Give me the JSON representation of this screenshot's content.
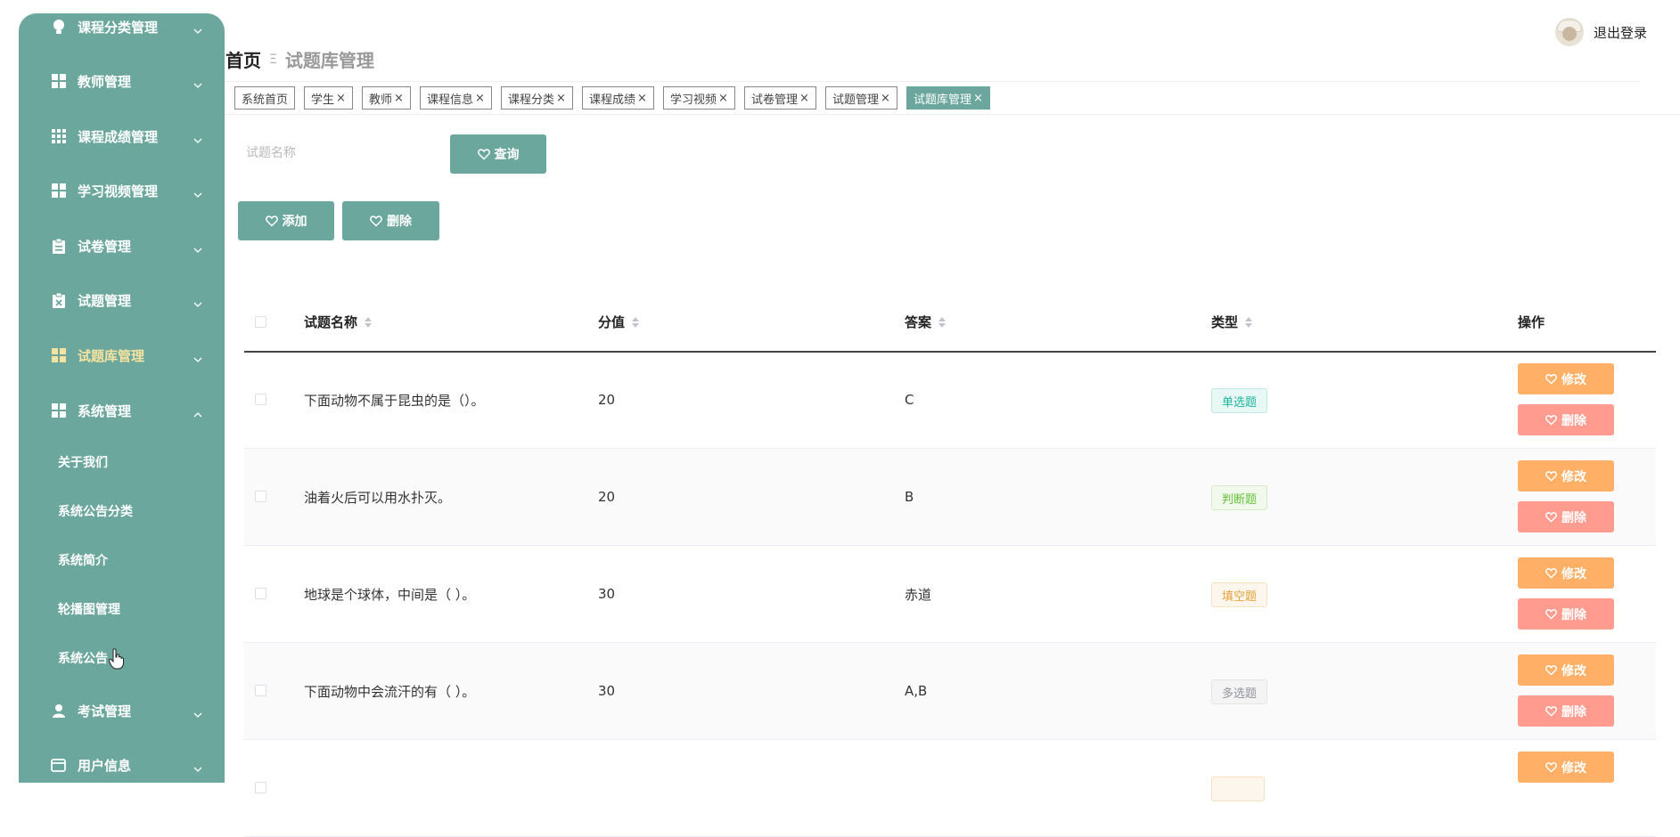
{
  "sidebar": {
    "menu": [
      {
        "label": "课程分类管理",
        "icon": "lightbulb-icon"
      },
      {
        "label": "教师管理",
        "icon": "grid-icon"
      },
      {
        "label": "课程成绩管理",
        "icon": "grid-9-icon"
      },
      {
        "label": "学习视频管理",
        "icon": "grid-icon"
      },
      {
        "label": "试卷管理",
        "icon": "clipboard-icon"
      },
      {
        "label": "试题管理",
        "icon": "clipboard-x-icon"
      },
      {
        "label": "试题库管理",
        "icon": "grid-icon",
        "active": true
      },
      {
        "label": "系统管理",
        "icon": "grid-icon",
        "expanded": true
      }
    ],
    "sub_items": [
      "关于我们",
      "系统公告分类",
      "系统简介",
      "轮播图管理",
      "系统公告"
    ],
    "menu_bottom": [
      {
        "label": "考试管理",
        "icon": "user-icon"
      },
      {
        "label": "用户信息",
        "icon": "card-icon"
      }
    ]
  },
  "header": {
    "home": "首页",
    "separator": "Ξ",
    "current": "试题库管理",
    "logout_label": "退出登录"
  },
  "tags": [
    {
      "label": "系统首页",
      "closable": false
    },
    {
      "label": "学生",
      "closable": true
    },
    {
      "label": "教师",
      "closable": true
    },
    {
      "label": "课程信息",
      "closable": true
    },
    {
      "label": "课程分类",
      "closable": true
    },
    {
      "label": "课程成绩",
      "closable": true
    },
    {
      "label": "学习视频",
      "closable": true
    },
    {
      "label": "试卷管理",
      "closable": true
    },
    {
      "label": "试题管理",
      "closable": true
    },
    {
      "label": "试题库管理",
      "closable": true,
      "active": true
    }
  ],
  "tag_close": "×",
  "search": {
    "placeholder": "试题名称",
    "button_label": "查询"
  },
  "actions": {
    "add_label": "添加",
    "delete_label": "删除"
  },
  "table": {
    "columns": [
      "试题名称",
      "分值",
      "答案",
      "类型",
      "操作"
    ],
    "rows": [
      {
        "name": "下面动物不属于昆虫的是（）。",
        "score": "20",
        "answer": "C",
        "type": "单选题",
        "type_color": "#1fb5a0"
      },
      {
        "name": "油着火后可以用水扑灭。",
        "score": "20",
        "answer": "B",
        "type": "判断题",
        "type_color": "#67c23a"
      },
      {
        "name": "地球是个球体，中间是（ ）。",
        "score": "30",
        "answer": "赤道",
        "type": "填空题",
        "type_color": "#e6a23c"
      },
      {
        "name": "下面动物中会流汗的有（ ）。",
        "score": "30",
        "answer": "A,B",
        "type": "多选题",
        "type_color": "#909399"
      },
      {
        "name": "",
        "score": "",
        "answer": "",
        "type": "",
        "type_color": "#e6a23c"
      }
    ],
    "edit_label": "修改",
    "delete_label": "删除"
  },
  "colors": {
    "primary": "#6ba79d",
    "edit": "#ffb066",
    "delete": "#ff9b8f",
    "active_menu": "#f7e3a1"
  }
}
